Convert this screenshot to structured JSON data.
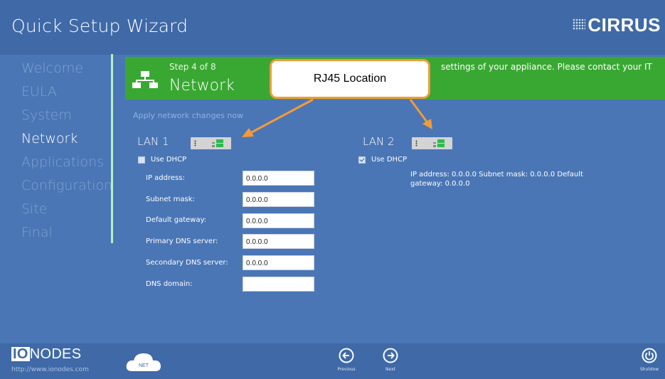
{
  "header": {
    "title": "Quick Setup Wizard",
    "brand": "CIRRUS"
  },
  "sidebar": {
    "items": [
      {
        "label": "Welcome"
      },
      {
        "label": "EULA"
      },
      {
        "label": "System"
      },
      {
        "label": "Network"
      },
      {
        "label": "Applications"
      },
      {
        "label": "Configuration"
      },
      {
        "label": "Site"
      },
      {
        "label": "Final"
      }
    ],
    "active": "Network"
  },
  "step": {
    "number": "Step 4 of 8",
    "title": "Network",
    "description": "settings of your appliance.  Please contact your IT"
  },
  "apply_link": "Apply network changes now",
  "callout": {
    "text": "RJ45 Location"
  },
  "lan1": {
    "title": "LAN 1",
    "dhcp_label": "Use DHCP",
    "dhcp_checked": false,
    "fields": [
      {
        "label": "IP address:",
        "value": "0.0.0.0"
      },
      {
        "label": "Subnet mask:",
        "value": "0.0.0.0"
      },
      {
        "label": "Default gateway:",
        "value": "0.0.0.0"
      },
      {
        "label": "Primary DNS server:",
        "value": "0.0.0.0"
      },
      {
        "label": "Secondary DNS server:",
        "value": "0.0.0.0"
      },
      {
        "label": "DNS domain:",
        "value": ""
      }
    ]
  },
  "lan2": {
    "title": "LAN 2",
    "dhcp_label": "Use DHCP",
    "dhcp_checked": true,
    "info": "IP address: 0.0.0.0  Subnet mask: 0.0.0.0  Default gateway: 0.0.0.0"
  },
  "footer": {
    "logo_io": "IO",
    "logo_rest": "NODES",
    "url": "http://www.ionodes.com",
    "cloud_label": "NET",
    "previous_label": "Previous",
    "next_label": "Next",
    "shutdown_label": "Shutdow"
  },
  "colors": {
    "background": "#4a76b5",
    "step_green": "#39a832",
    "callout_orange": "#f29b3a"
  }
}
